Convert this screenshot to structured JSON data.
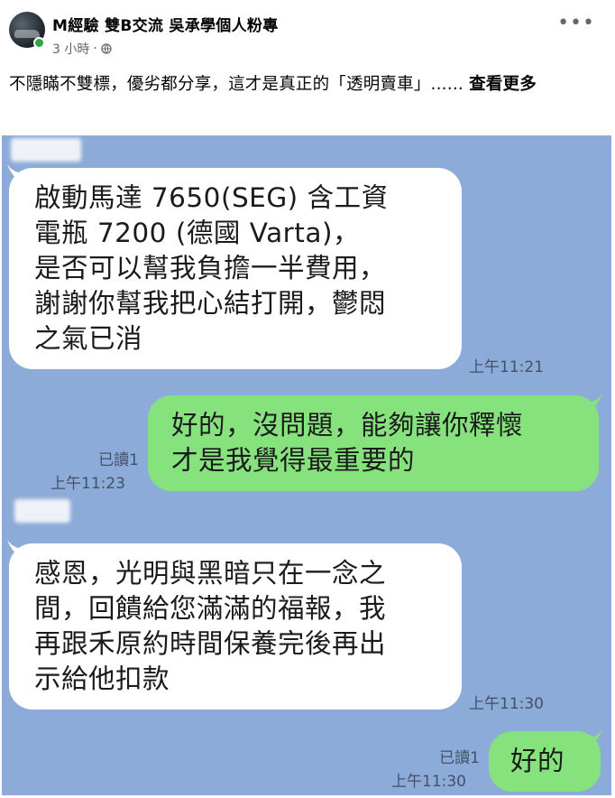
{
  "post": {
    "page_name": "M經驗 雙B交流 吳承學個人粉專",
    "time": "3 小時",
    "dot": "·",
    "text": "不隱瞞不雙標，優劣都分享，這才是真正的「透明賣車」......",
    "see_more": "查看更多",
    "icons": [
      "avatar",
      "online-status-icon",
      "globe-icon",
      "more-options-icon"
    ],
    "colors": {
      "online": "#31a24c",
      "meta": "#65676b"
    }
  },
  "chat": {
    "colors": {
      "background": "#8dabd8",
      "incoming": "#ffffff",
      "outgoing": "#85e27c"
    },
    "messages": [
      {
        "side": "incoming",
        "lines": [
          "啟動馬達 7650(SEG) 含工資",
          "電瓶 7200 (德國 Varta)，",
          "是否可以幫我負擔一半費用，",
          "謝謝你幫我把心結打開，鬱悶",
          "之氣已消"
        ],
        "time": "上午11:21"
      },
      {
        "side": "outgoing",
        "lines": [
          "好的，沒問題，能夠讓你釋懷",
          "才是我覺得最重要的"
        ],
        "read": "已讀1",
        "time": "上午11:23"
      },
      {
        "side": "incoming",
        "lines": [
          "感恩，光明與黑暗只在一念之",
          "間，回饋給您滿滿的福報，我",
          "再跟禾原約時間保養完後再出",
          "示給他扣款"
        ],
        "time": "上午11:30"
      },
      {
        "side": "outgoing",
        "lines": [
          "好的"
        ],
        "read": "已讀1",
        "time": "上午11:30"
      }
    ]
  }
}
